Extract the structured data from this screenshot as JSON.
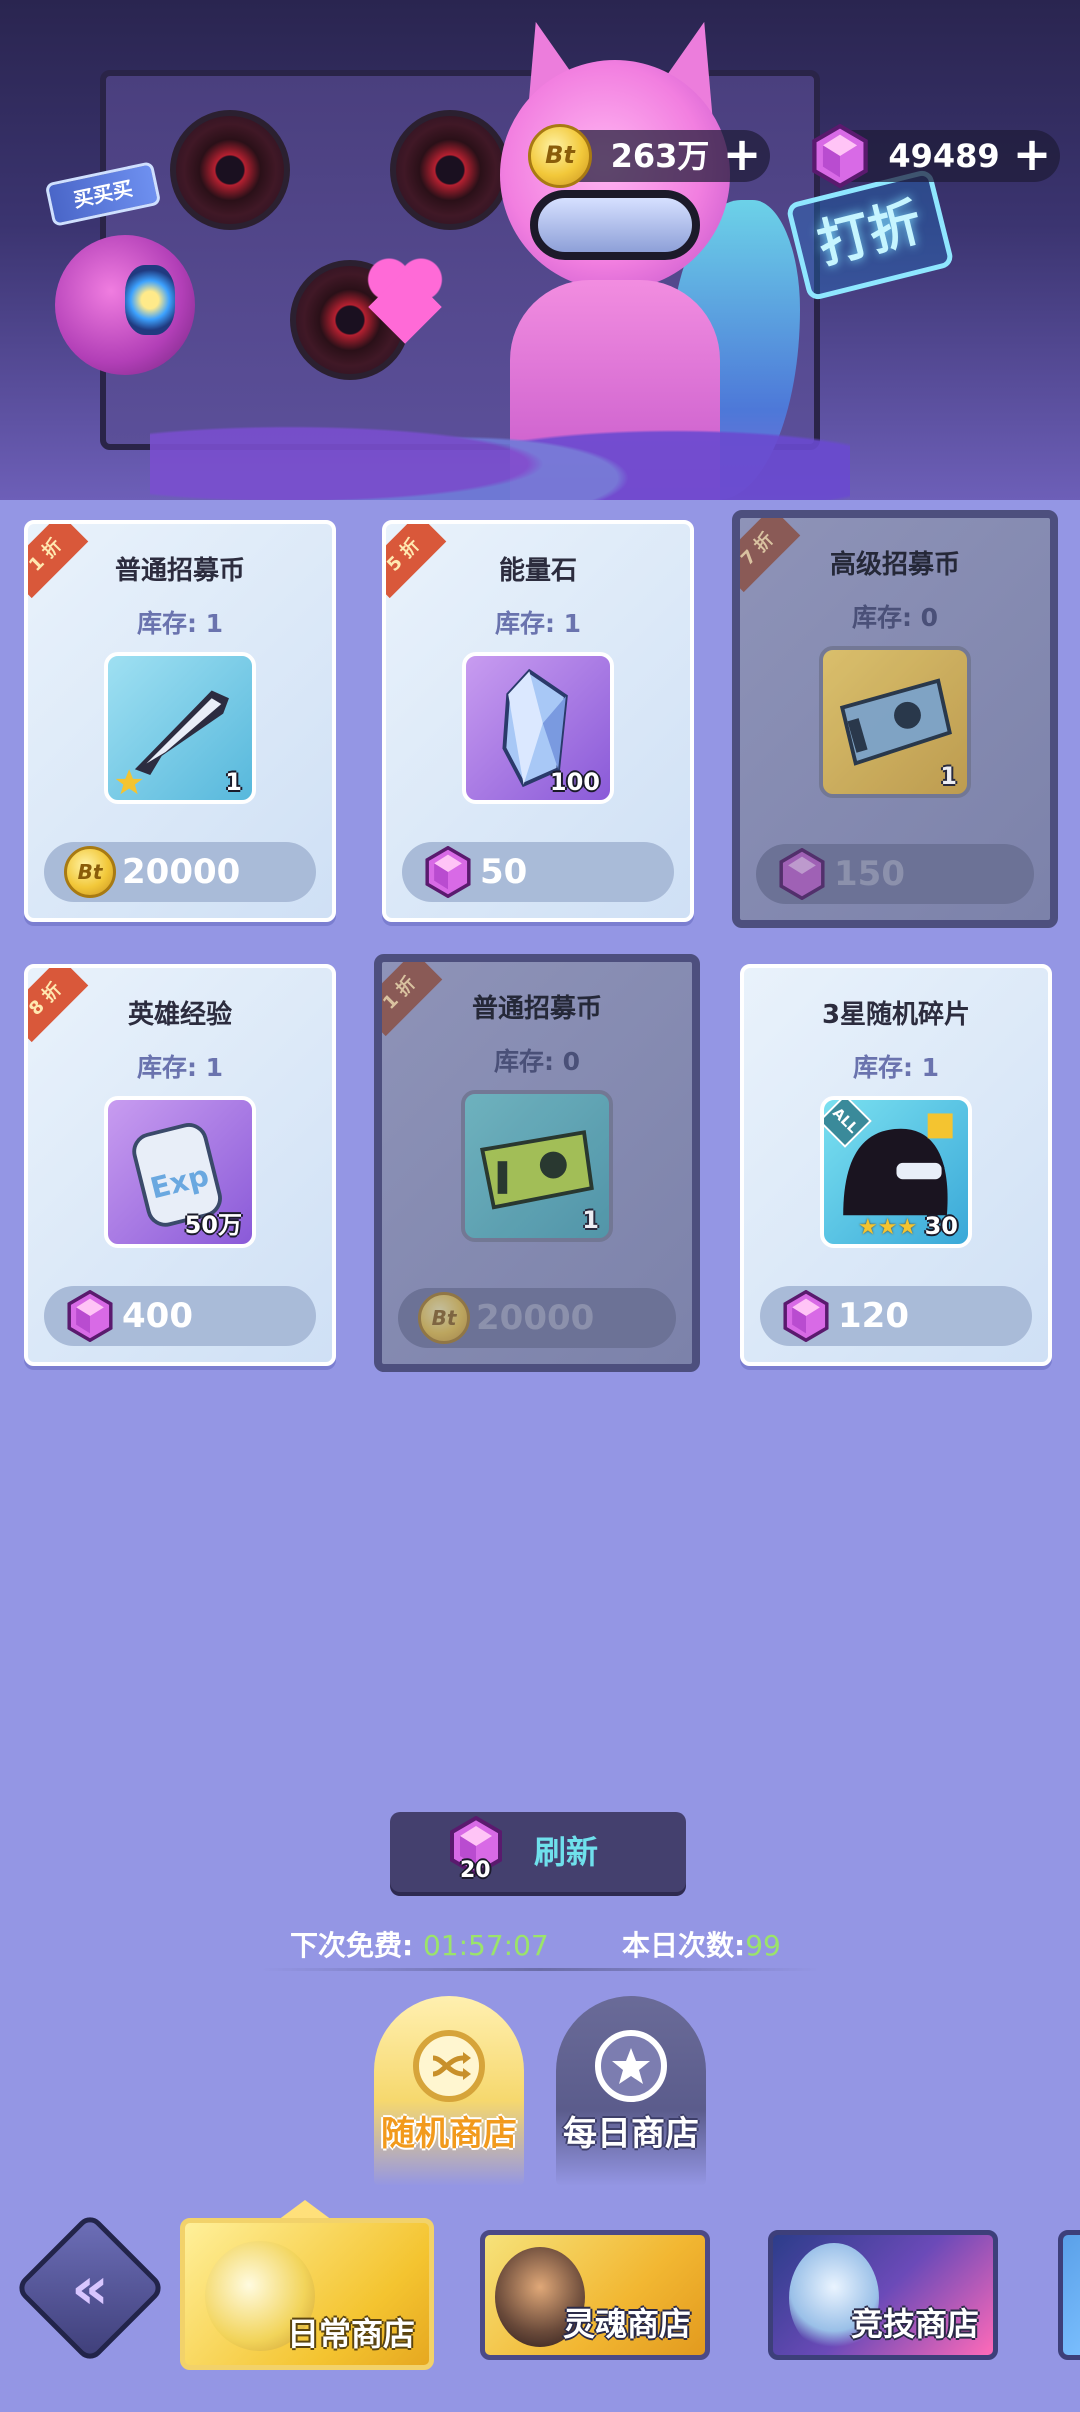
{
  "hero": {
    "buy_sign": "买买买",
    "discount_sign": "打折"
  },
  "currency": {
    "gold": {
      "icon": "bt-coin-icon",
      "value": "263万"
    },
    "gem": {
      "icon": "purple-gem-icon",
      "value": "49489"
    }
  },
  "shop_items": [
    {
      "discount": "1 折",
      "name": "普通招募币",
      "stock": "库存: 1",
      "item_icon": "recruit-ticket-glasses-icon",
      "qty": "1",
      "price_icon": "bt-coin-icon",
      "price": "20000",
      "sold_out": false
    },
    {
      "discount": "5 折",
      "name": "能量石",
      "stock": "库存: 1",
      "item_icon": "energy-crystal-icon",
      "qty": "100",
      "price_icon": "purple-gem-icon",
      "price": "50",
      "sold_out": false
    },
    {
      "discount": "7 折",
      "name": "高级招募币",
      "stock": "库存: 0",
      "item_icon": "premium-ticket-icon",
      "qty": "1",
      "price_icon": "purple-gem-icon",
      "price": "150",
      "sold_out": true
    },
    {
      "discount": "8 折",
      "name": "英雄经验",
      "stock": "库存: 1",
      "item_icon": "exp-canister-icon",
      "qty": "50万",
      "price_icon": "purple-gem-icon",
      "price": "400",
      "sold_out": false
    },
    {
      "discount": "1 折",
      "name": "普通招募币",
      "stock": "库存: 0",
      "item_icon": "recruit-ticket-icon",
      "qty": "1",
      "price_icon": "bt-coin-icon",
      "price": "20000",
      "sold_out": true
    },
    {
      "discount": "",
      "name": "3星随机碎片",
      "stock": "库存: 1",
      "item_icon": "hero-shard-icon",
      "badge": "ALL",
      "qty": "30",
      "price_icon": "purple-gem-icon",
      "price": "120",
      "sold_out": false
    }
  ],
  "refresh": {
    "label": "刷新",
    "cost": "20",
    "next_free_label": "下次免费:",
    "next_free_time": "01:57:07",
    "today_count_label": "本日次数:",
    "today_count": "99"
  },
  "sub_tabs": [
    {
      "label": "随机商店",
      "icon": "random-shop-icon",
      "active": true
    },
    {
      "label": "每日商店",
      "icon": "daily-star-icon",
      "active": false
    }
  ],
  "shop_tabs": [
    {
      "label": "日常商店",
      "icon": "gold-coins-bag-icon",
      "active": true
    },
    {
      "label": "灵魂商店",
      "icon": "hero-portrait-icon",
      "active": false
    },
    {
      "label": "竞技商店",
      "icon": "crystal-dragon-icon",
      "active": false
    }
  ],
  "nav": {
    "back_icon": "double-chevron-left-icon"
  },
  "colors": {
    "page_bg": "#9496e4",
    "discount_ribbon": "#d9583a",
    "refresh_accent": "#6fe0ec",
    "timer_green": "#9be46a",
    "active_tab_orange": "#f29a1c"
  }
}
